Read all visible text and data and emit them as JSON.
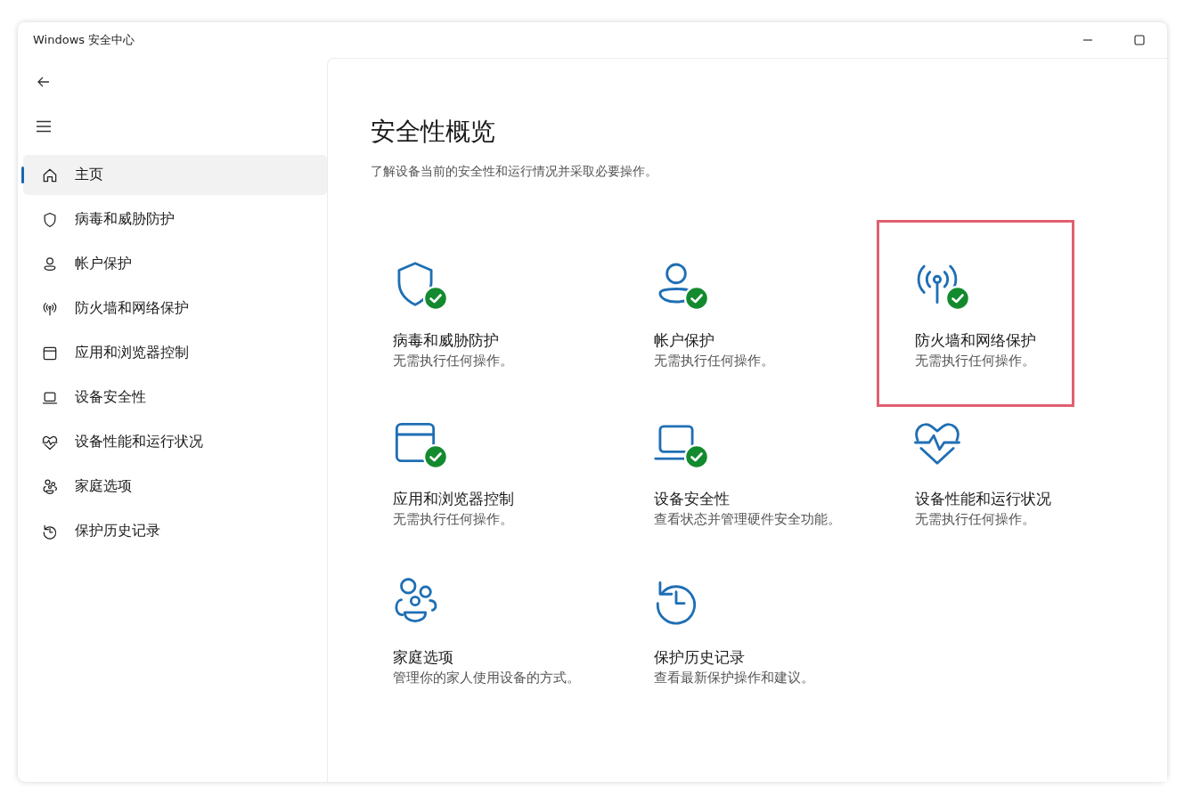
{
  "window": {
    "title": "Windows 安全中心"
  },
  "sidebar": {
    "items": [
      {
        "label": "主页",
        "kind": "home",
        "selected": true
      },
      {
        "label": "病毒和威胁防护",
        "kind": "shield",
        "selected": false
      },
      {
        "label": "帐户保护",
        "kind": "person",
        "selected": false
      },
      {
        "label": "防火墙和网络保护",
        "kind": "antenna",
        "selected": false
      },
      {
        "label": "应用和浏览器控制",
        "kind": "browser",
        "selected": false
      },
      {
        "label": "设备安全性",
        "kind": "laptop",
        "selected": false
      },
      {
        "label": "设备性能和运行状况",
        "kind": "heart",
        "selected": false
      },
      {
        "label": "家庭选项",
        "kind": "family",
        "selected": false
      },
      {
        "label": "保护历史记录",
        "kind": "history",
        "selected": false
      }
    ]
  },
  "main": {
    "title": "安全性概览",
    "subtitle": "了解设备当前的安全性和运行情况并采取必要操作。",
    "cards": [
      {
        "title": "病毒和威胁防护",
        "status": "无需执行任何操作。",
        "kind": "shield",
        "ok": true,
        "highlighted": false
      },
      {
        "title": "帐户保护",
        "status": "无需执行任何操作。",
        "kind": "person",
        "ok": true,
        "highlighted": false
      },
      {
        "title": "防火墙和网络保护",
        "status": "无需执行任何操作。",
        "kind": "antenna",
        "ok": true,
        "highlighted": true
      },
      {
        "title": "应用和浏览器控制",
        "status": "无需执行任何操作。",
        "kind": "browser",
        "ok": true,
        "highlighted": false
      },
      {
        "title": "设备安全性",
        "status": "查看状态并管理硬件安全功能。",
        "kind": "laptop",
        "ok": true,
        "highlighted": false
      },
      {
        "title": "设备性能和运行状况",
        "status": "无需执行任何操作。",
        "kind": "heart",
        "ok": false,
        "highlighted": false
      },
      {
        "title": "家庭选项",
        "status": "管理你的家人使用设备的方式。",
        "kind": "family",
        "ok": false,
        "highlighted": false
      },
      {
        "title": "保护历史记录",
        "status": "查看最新保护操作和建议。",
        "kind": "history",
        "ok": false,
        "highlighted": false
      }
    ]
  }
}
